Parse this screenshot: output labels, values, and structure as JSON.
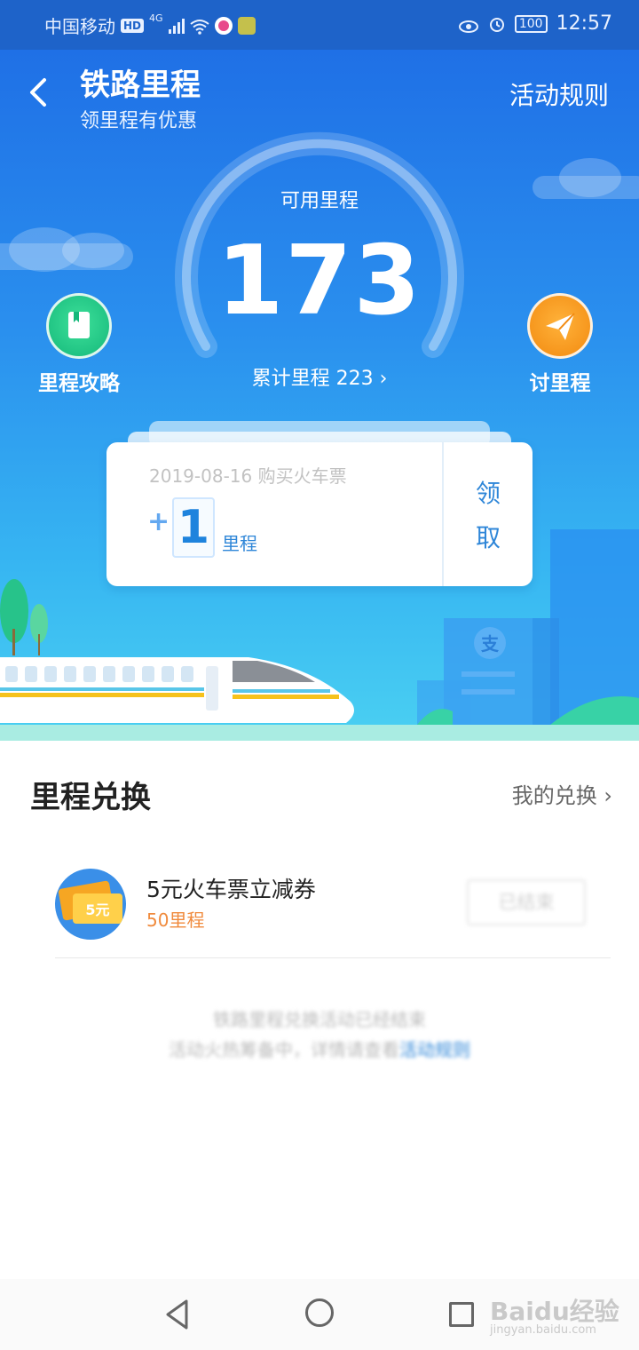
{
  "status_bar": {
    "carrier": "中国移动",
    "hd": "HD",
    "network": "4G",
    "battery": "100",
    "time": "12:57"
  },
  "header": {
    "title": "铁路里程",
    "subtitle": "领里程有优惠",
    "rules_link": "活动规则"
  },
  "mileage": {
    "available_label": "可用里程",
    "available_value": "173",
    "total_label": "累计里程 223",
    "total_chevron": "›"
  },
  "side_buttons": {
    "guide_label": "里程攻略",
    "request_label": "讨里程"
  },
  "claim_card": {
    "date_text": "2019-08-16 购买火车票",
    "plus": "+",
    "amount": "1",
    "unit": "里程",
    "claim_char1": "领",
    "claim_char2": "取"
  },
  "exchange": {
    "section_title": "里程兑换",
    "my_exchange_link": "我的兑换 ›",
    "items": [
      {
        "icon_text": "5元",
        "name": "5元火车票立减券",
        "cost": "50里程",
        "button": "已结束"
      }
    ],
    "notice_line1": "铁路里程兑换活动已经结束",
    "notice_line2_prefix": "活动火热筹备中，详情请查看",
    "notice_line2_link": "活动规则"
  },
  "watermark": {
    "brand": "Baidu经验",
    "url": "jingyan.baidu.com"
  },
  "colors": {
    "accent": "#2e86d8",
    "hero_top": "#1f70e6",
    "hero_bottom": "#4ad0f2",
    "cost_orange": "#f08a3c"
  }
}
